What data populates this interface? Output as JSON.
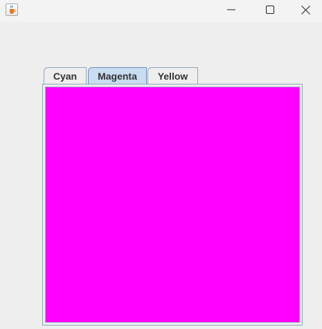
{
  "window": {
    "icon": "java-cup-icon"
  },
  "tabs": [
    {
      "label": "Cyan",
      "selected": false
    },
    {
      "label": "Magenta",
      "selected": true
    },
    {
      "label": "Yellow",
      "selected": false
    }
  ],
  "panel": {
    "color": "#ff00ff"
  },
  "colors": {
    "tab_selected_bg": "#c8dcf2",
    "tab_border": "#8da5bd",
    "window_bg": "#eeeeee"
  }
}
